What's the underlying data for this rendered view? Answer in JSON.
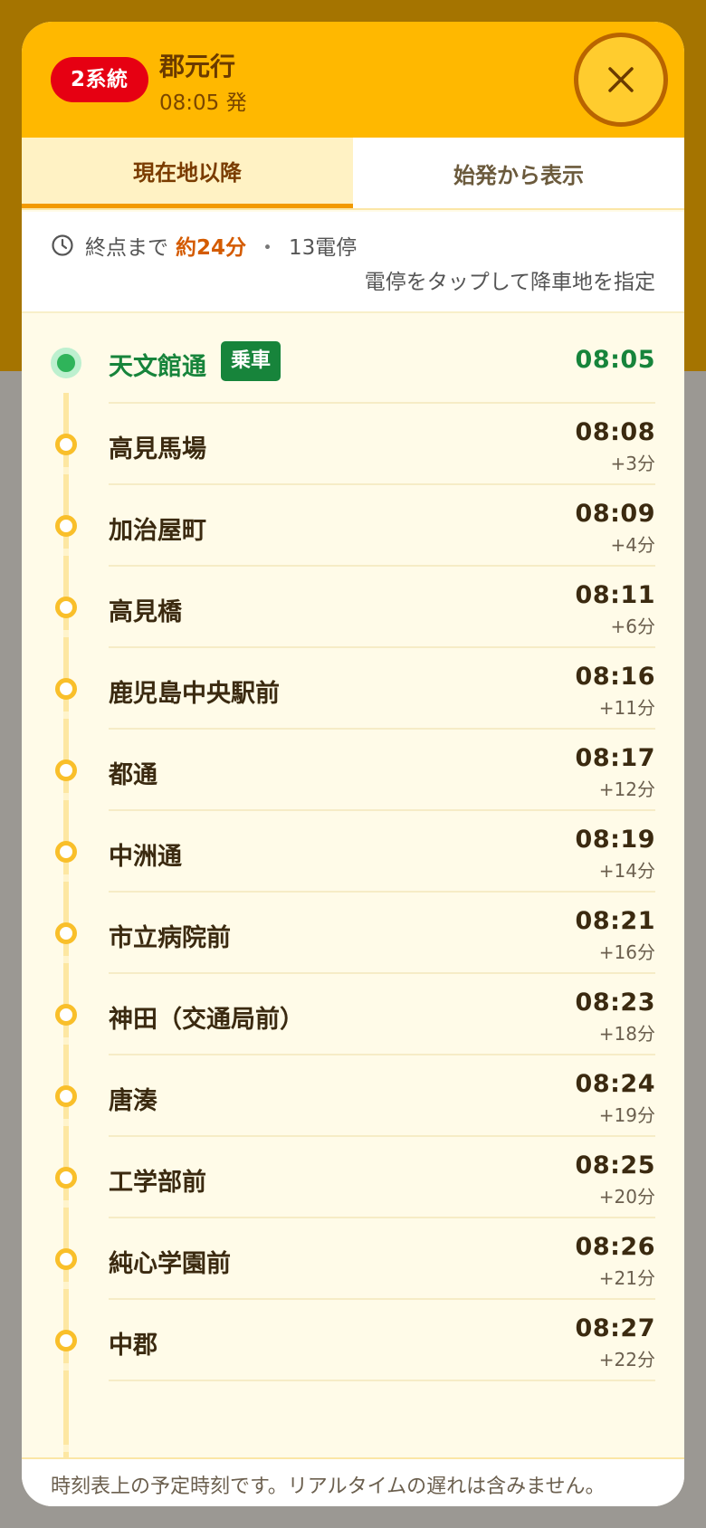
{
  "header": {
    "route_badge": "2系統",
    "destination": "郡元行",
    "departure": "08:05 発",
    "close_label": "×"
  },
  "tabs": [
    {
      "label": "現在地以降",
      "active": true
    },
    {
      "label": "始発から表示",
      "active": false
    }
  ],
  "info": {
    "to_end_label": "終点まで",
    "duration": "約24分",
    "separator": "・",
    "stop_count": "13電停",
    "hint": "電停をタップして降車地を指定"
  },
  "boarding_tag": "乗車",
  "stops": [
    {
      "name": "天文館通",
      "time": "08:05",
      "delta": "",
      "boarding": true
    },
    {
      "name": "高見馬場",
      "time": "08:08",
      "delta": "+3分"
    },
    {
      "name": "加治屋町",
      "time": "08:09",
      "delta": "+4分"
    },
    {
      "name": "高見橋",
      "time": "08:11",
      "delta": "+6分"
    },
    {
      "name": "鹿児島中央駅前",
      "time": "08:16",
      "delta": "+11分"
    },
    {
      "name": "都通",
      "time": "08:17",
      "delta": "+12分"
    },
    {
      "name": "中洲通",
      "time": "08:19",
      "delta": "+14分"
    },
    {
      "name": "市立病院前",
      "time": "08:21",
      "delta": "+16分"
    },
    {
      "name": "神田（交通局前）",
      "time": "08:23",
      "delta": "+18分"
    },
    {
      "name": "唐湊",
      "time": "08:24",
      "delta": "+19分"
    },
    {
      "name": "工学部前",
      "time": "08:25",
      "delta": "+20分"
    },
    {
      "name": "純心学園前",
      "time": "08:26",
      "delta": "+21分"
    },
    {
      "name": "中郡",
      "time": "08:27",
      "delta": "+22分"
    }
  ],
  "footer": {
    "note": "時刻表上の予定時刻です。リアルタイムの遅れは含みません。"
  },
  "colors": {
    "header": "#ffb800",
    "route_badge": "#e60012",
    "boarding": "#17843b",
    "stop_dot": "#f9bf2a",
    "duration": "#d45b00"
  }
}
